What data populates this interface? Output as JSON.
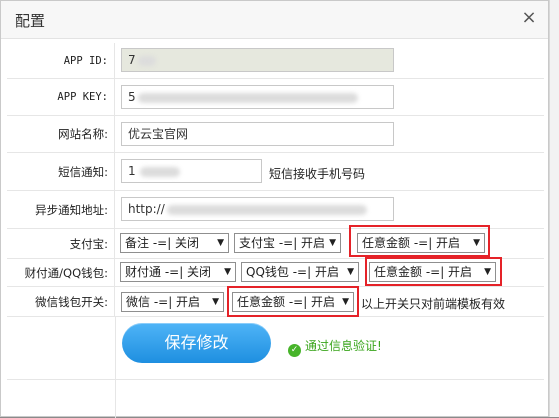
{
  "dialog": {
    "title": "配置",
    "close_label": "×"
  },
  "fields": {
    "app_id": {
      "label": "APP ID:",
      "value": "7"
    },
    "app_key": {
      "label": "APP KEY:",
      "value": "5"
    },
    "site_name": {
      "label": "网站名称:",
      "value": "优云宝官网"
    },
    "sms": {
      "label": "短信通知:",
      "value": "1",
      "hint": "短信接收手机号码"
    },
    "notify_url": {
      "label": "异步通知地址:",
      "value": "http://"
    }
  },
  "alipay": {
    "label": "支付宝:",
    "selects": [
      "备注 -=| 关闭",
      "支付宝 -=| 开启",
      "任意金额 -=| 开启"
    ]
  },
  "tenpay": {
    "label": "财付通/QQ钱包:",
    "selects": [
      "财付通 -=| 关闭",
      "QQ钱包 -=| 开启",
      "任意金额 -=| 开启"
    ]
  },
  "wechat": {
    "label": "微信钱包开关:",
    "selects": [
      "微信 -=| 开启",
      "任意金额 -=| 开启"
    ],
    "note": "以上开关只对前端模板有效"
  },
  "actions": {
    "save_label": "保存修改",
    "status_icon": "✓",
    "status_text": "通过信息验证!"
  },
  "colors": {
    "highlight": "#e52228",
    "button": "#2196e8",
    "success": "#3aa51c"
  }
}
